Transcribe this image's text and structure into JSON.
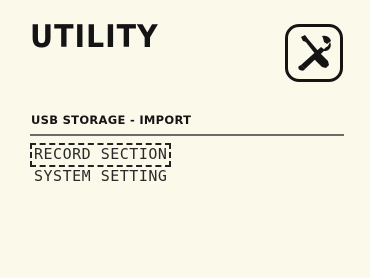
{
  "header": {
    "title": "UTILITY",
    "icon": "tools-icon"
  },
  "section": {
    "label": "USB STORAGE - IMPORT"
  },
  "menu": {
    "items": [
      {
        "label": "RECORD SECTION",
        "selected": true
      },
      {
        "label": "SYSTEM SETTING",
        "selected": false
      }
    ]
  },
  "colors": {
    "background": "#fbf9ea",
    "text": "#141414",
    "divider": "#6c6c66"
  }
}
